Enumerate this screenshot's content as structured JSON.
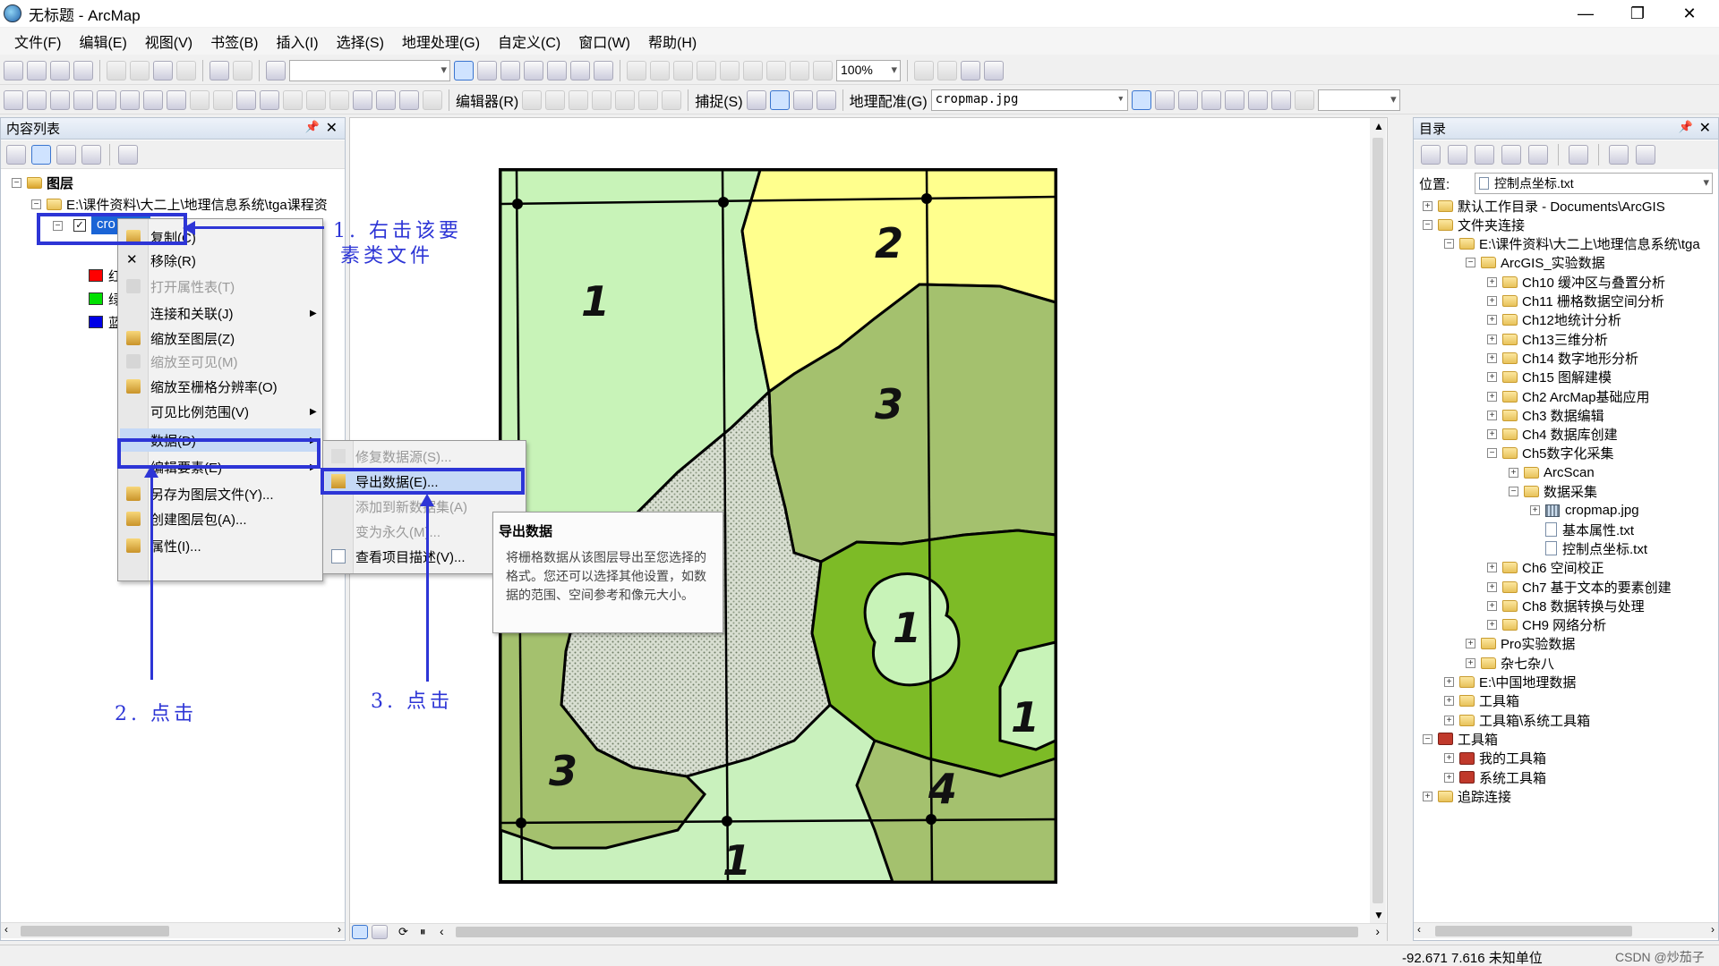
{
  "window": {
    "title": "无标题 - ArcMap",
    "minimize": "—",
    "restore": "❐",
    "close": "✕"
  },
  "menubar": [
    "文件(F)",
    "编辑(E)",
    "视图(V)",
    "书签(B)",
    "插入(I)",
    "选择(S)",
    "地理处理(G)",
    "自定义(C)",
    "窗口(W)",
    "帮助(H)"
  ],
  "toolbar": {
    "zoom": "100%",
    "editor_label": "编辑器(R)",
    "snapping_label": "捕捉(S)",
    "georef_label": "地理配准(G)",
    "georef_layer": "cropmap.jpg"
  },
  "toc": {
    "title": "内容列表",
    "layers_label": "图层",
    "path_label": "E:\\课件资料\\大二上\\地理信息系统\\tga课程资",
    "layer_name": "cro",
    "legend": [
      {
        "color": "#ff0000",
        "label": "红"
      },
      {
        "color": "#00e000",
        "label": "绿"
      },
      {
        "color": "#0000e6",
        "label": "蓝"
      }
    ]
  },
  "context_menu": {
    "items": [
      {
        "label": "复制(C)",
        "disabled": false,
        "icon": "copy-icon"
      },
      {
        "label": "移除(R)",
        "disabled": false,
        "icon": "remove-icon"
      },
      {
        "label": "打开属性表(T)",
        "disabled": true,
        "icon": "table-icon"
      },
      {
        "label": "连接和关联(J)",
        "disabled": false,
        "icon": "",
        "submenu": true
      },
      {
        "label": "缩放至图层(Z)",
        "disabled": false,
        "icon": "zoom-layer-icon"
      },
      {
        "label": "缩放至可见(M)",
        "disabled": true,
        "icon": "zoom-visible-icon"
      },
      {
        "label": "缩放至栅格分辨率(O)",
        "disabled": false,
        "icon": "raster-resolution-icon"
      },
      {
        "label": "可见比例范围(V)",
        "disabled": false,
        "icon": "",
        "submenu": true
      },
      {
        "label": "数据(D)",
        "disabled": false,
        "icon": "",
        "submenu": true,
        "highlight": true
      },
      {
        "label": "编辑要素(E)",
        "disabled": false,
        "icon": "",
        "submenu": true
      },
      {
        "label": "另存为图层文件(Y)...",
        "disabled": false,
        "icon": "layer-file-icon"
      },
      {
        "label": "创建图层包(A)...",
        "disabled": false,
        "icon": "layer-package-icon"
      },
      {
        "label": "属性(I)...",
        "disabled": false,
        "icon": "properties-icon"
      }
    ]
  },
  "submenu": {
    "items": [
      {
        "label": "修复数据源(S)...",
        "disabled": true
      },
      {
        "label": "导出数据(E)...",
        "disabled": false,
        "highlight": true
      },
      {
        "label": "添加到新数据集(A)",
        "disabled": true
      },
      {
        "label": "变为永久(M)...",
        "disabled": true
      },
      {
        "label": "查看项目描述(V)...",
        "disabled": false
      }
    ]
  },
  "tooltip": {
    "title": "导出数据",
    "body": "将栅格数据从该图层导出至您选择的格式。您还可以选择其他设置，如数据的范围、空间参考和像元大小。"
  },
  "annotations": {
    "step1_line1": "1. 右击该要",
    "step1_line2": "素类文件",
    "step2": "2. 点击",
    "step3": "3. 点击"
  },
  "map_labels": [
    "1",
    "2",
    "3",
    "1",
    "1",
    "3",
    "4",
    "1"
  ],
  "catalog": {
    "title": "目录",
    "location_label": "位置:",
    "location_value": "控制点坐标.txt",
    "nodes": [
      {
        "label": "默认工作目录 - Documents\\ArcGIS",
        "level": 0,
        "exp": "+",
        "type": "folder"
      },
      {
        "label": "文件夹连接",
        "level": 0,
        "exp": "−",
        "type": "folder"
      },
      {
        "label": "E:\\课件资料\\大二上\\地理信息系统\\tga",
        "level": 1,
        "exp": "−",
        "type": "folder"
      },
      {
        "label": "ArcGIS_实验数据",
        "level": 2,
        "exp": "−",
        "type": "folder"
      },
      {
        "label": "Ch10 缓冲区与叠置分析",
        "level": 3,
        "exp": "+",
        "type": "folder"
      },
      {
        "label": "Ch11 栅格数据空间分析",
        "level": 3,
        "exp": "+",
        "type": "folder"
      },
      {
        "label": "Ch12地统计分析",
        "level": 3,
        "exp": "+",
        "type": "folder"
      },
      {
        "label": "Ch13三维分析",
        "level": 3,
        "exp": "+",
        "type": "folder"
      },
      {
        "label": "Ch14 数字地形分析",
        "level": 3,
        "exp": "+",
        "type": "folder"
      },
      {
        "label": "Ch15 图解建模",
        "level": 3,
        "exp": "+",
        "type": "folder"
      },
      {
        "label": "Ch2  ArcMap基础应用",
        "level": 3,
        "exp": "+",
        "type": "folder"
      },
      {
        "label": "Ch3 数据编辑",
        "level": 3,
        "exp": "+",
        "type": "folder"
      },
      {
        "label": "Ch4 数据库创建",
        "level": 3,
        "exp": "+",
        "type": "folder"
      },
      {
        "label": "Ch5数字化采集",
        "level": 3,
        "exp": "−",
        "type": "folder"
      },
      {
        "label": "ArcScan",
        "level": 4,
        "exp": "+",
        "type": "folder"
      },
      {
        "label": "数据采集",
        "level": 4,
        "exp": "−",
        "type": "folder"
      },
      {
        "label": "cropmap.jpg",
        "level": 5,
        "exp": "+",
        "type": "raster"
      },
      {
        "label": "基本属性.txt",
        "level": 5,
        "exp": "",
        "type": "file"
      },
      {
        "label": "控制点坐标.txt",
        "level": 5,
        "exp": "",
        "type": "file"
      },
      {
        "label": "Ch6 空间校正",
        "level": 3,
        "exp": "+",
        "type": "folder"
      },
      {
        "label": "Ch7 基于文本的要素创建",
        "level": 3,
        "exp": "+",
        "type": "folder"
      },
      {
        "label": "Ch8 数据转换与处理",
        "level": 3,
        "exp": "+",
        "type": "folder"
      },
      {
        "label": "CH9 网络分析",
        "level": 3,
        "exp": "+",
        "type": "folder"
      },
      {
        "label": "Pro实验数据",
        "level": 2,
        "exp": "+",
        "type": "folder"
      },
      {
        "label": "杂七杂八",
        "level": 2,
        "exp": "+",
        "type": "folder"
      },
      {
        "label": "E:\\中国地理数据",
        "level": 1,
        "exp": "+",
        "type": "folder"
      },
      {
        "label": "工具箱",
        "level": 1,
        "exp": "+",
        "type": "folder"
      },
      {
        "label": "工具箱\\系统工具箱",
        "level": 1,
        "exp": "+",
        "type": "folder"
      },
      {
        "label": "工具箱",
        "level": 0,
        "exp": "−",
        "type": "toolbox"
      },
      {
        "label": "我的工具箱",
        "level": 1,
        "exp": "+",
        "type": "toolbox"
      },
      {
        "label": "系统工具箱",
        "level": 1,
        "exp": "+",
        "type": "toolbox"
      },
      {
        "label": "追踪连接",
        "level": 0,
        "exp": "+",
        "type": "folder"
      }
    ]
  },
  "status": {
    "coords": "-92.671  7.616 未知单位",
    "watermark": "CSDN @炒茄子"
  },
  "colors": {
    "accent": "#2d35d6",
    "menu_highlight": "#c5d9f6"
  }
}
